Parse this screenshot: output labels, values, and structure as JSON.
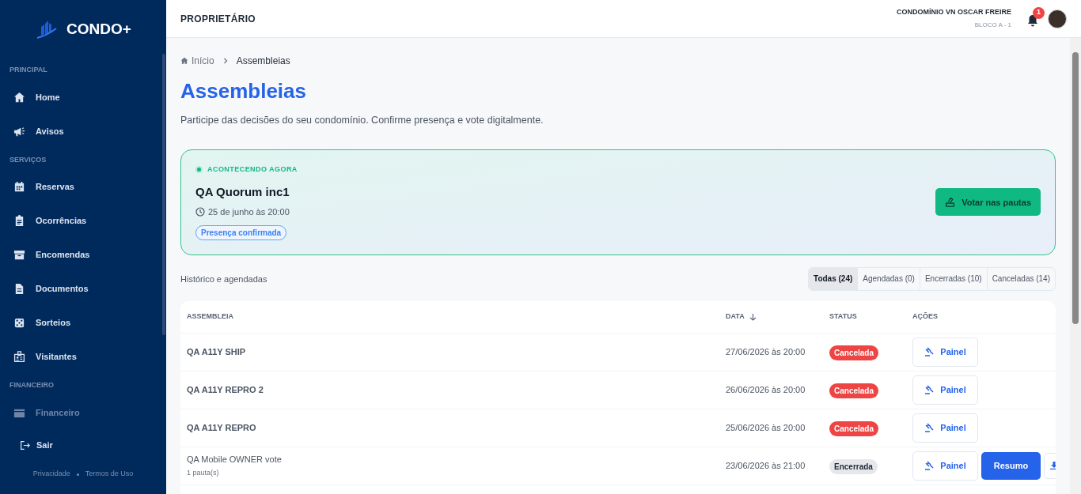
{
  "sidebar": {
    "brand": "CONDO+",
    "sections": [
      {
        "title": "PRINCIPAL",
        "items": [
          {
            "label": "Home",
            "faded": false
          },
          {
            "label": "Avisos",
            "faded": false
          }
        ]
      },
      {
        "title": "SERVIÇOS",
        "items": [
          {
            "label": "Reservas",
            "faded": false
          },
          {
            "label": "Ocorrências",
            "faded": false
          },
          {
            "label": "Encomendas",
            "faded": false
          },
          {
            "label": "Documentos",
            "faded": false
          },
          {
            "label": "Sorteios",
            "faded": false
          },
          {
            "label": "Visitantes",
            "faded": false
          }
        ]
      },
      {
        "title": "FINANCEIRO",
        "items": [
          {
            "label": "Financeiro",
            "faded": true
          }
        ]
      }
    ],
    "logout": "Sair",
    "footer_links": [
      "Privacidade",
      "Termos de Uso"
    ]
  },
  "header": {
    "role": "PROPRIETÁRIO",
    "condo": "CONDOMÍNIO VN OSCAR FREIRE",
    "unit": "BLOCO A - 1",
    "notifications": "1"
  },
  "breadcrumb": [
    "Início",
    "Assembleias"
  ],
  "page": {
    "title": "Assembleias",
    "subtitle": "Participe das decisões do seu condomínio. Confirme presença e vote digitalmente."
  },
  "live": {
    "status": "ACONTECENDO AGORA",
    "title": "QA Quorum inc1",
    "when": "25 de junho às 20:00",
    "badge": "Presença confirmada",
    "button": "Votar nas pautas"
  },
  "history": {
    "label": "Histórico e agendadas",
    "filters": [
      {
        "label": "Todas (24)",
        "selected": true
      },
      {
        "label": "Agendadas (0)",
        "selected": false
      },
      {
        "label": "Encerradas (10)",
        "selected": false
      },
      {
        "label": "Canceladas (14)",
        "selected": false
      }
    ]
  },
  "table": {
    "columns": [
      "ASSEMBLEIA",
      "DATA",
      "STATUS",
      "AÇÕES"
    ],
    "rows": [
      {
        "name": "QA A11Y SHIP",
        "date": "27/06/2026 às 20:00",
        "status": {
          "label": "Cancelada",
          "kind": "cancelled"
        },
        "actions": [
          {
            "kind": "panel",
            "label": "Painel"
          }
        ]
      },
      {
        "name": "QA A11Y REPRO 2",
        "date": "26/06/2026 às 20:00",
        "status": {
          "label": "Cancelada",
          "kind": "cancelled"
        },
        "actions": [
          {
            "kind": "panel",
            "label": "Painel"
          }
        ]
      },
      {
        "name": "QA A11Y REPRO",
        "date": "25/06/2026 às 20:00",
        "status": {
          "label": "Cancelada",
          "kind": "cancelled"
        },
        "actions": [
          {
            "kind": "panel",
            "label": "Painel"
          }
        ]
      },
      {
        "name": "QA Mobile OWNER vote",
        "detail": "1 pauta(s)",
        "date": "23/06/2026 às 21:00",
        "status": {
          "label": "Encerrada",
          "kind": "closed"
        },
        "actions": [
          {
            "kind": "panel",
            "label": "Painel"
          },
          {
            "kind": "summary",
            "label": "Resumo"
          },
          {
            "kind": "download"
          }
        ]
      }
    ]
  }
}
